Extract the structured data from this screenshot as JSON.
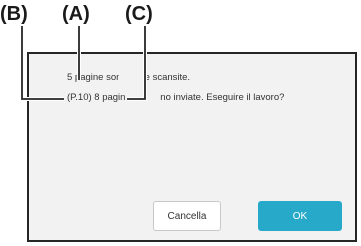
{
  "callouts": {
    "a": "(A)",
    "b": "(B)",
    "c": "(C)"
  },
  "dialog": {
    "line1": "5 pagine sono state scansite.",
    "line2": "(P.10) 8 pagine verranno inviate. Eseguire il lavoro?"
  },
  "buttons": {
    "cancel_label": "Cancella",
    "ok_label": "OK"
  },
  "colors": {
    "ok_button": "#27a9c9",
    "screen_background": "#f2f2f2",
    "frame": "#262626"
  }
}
